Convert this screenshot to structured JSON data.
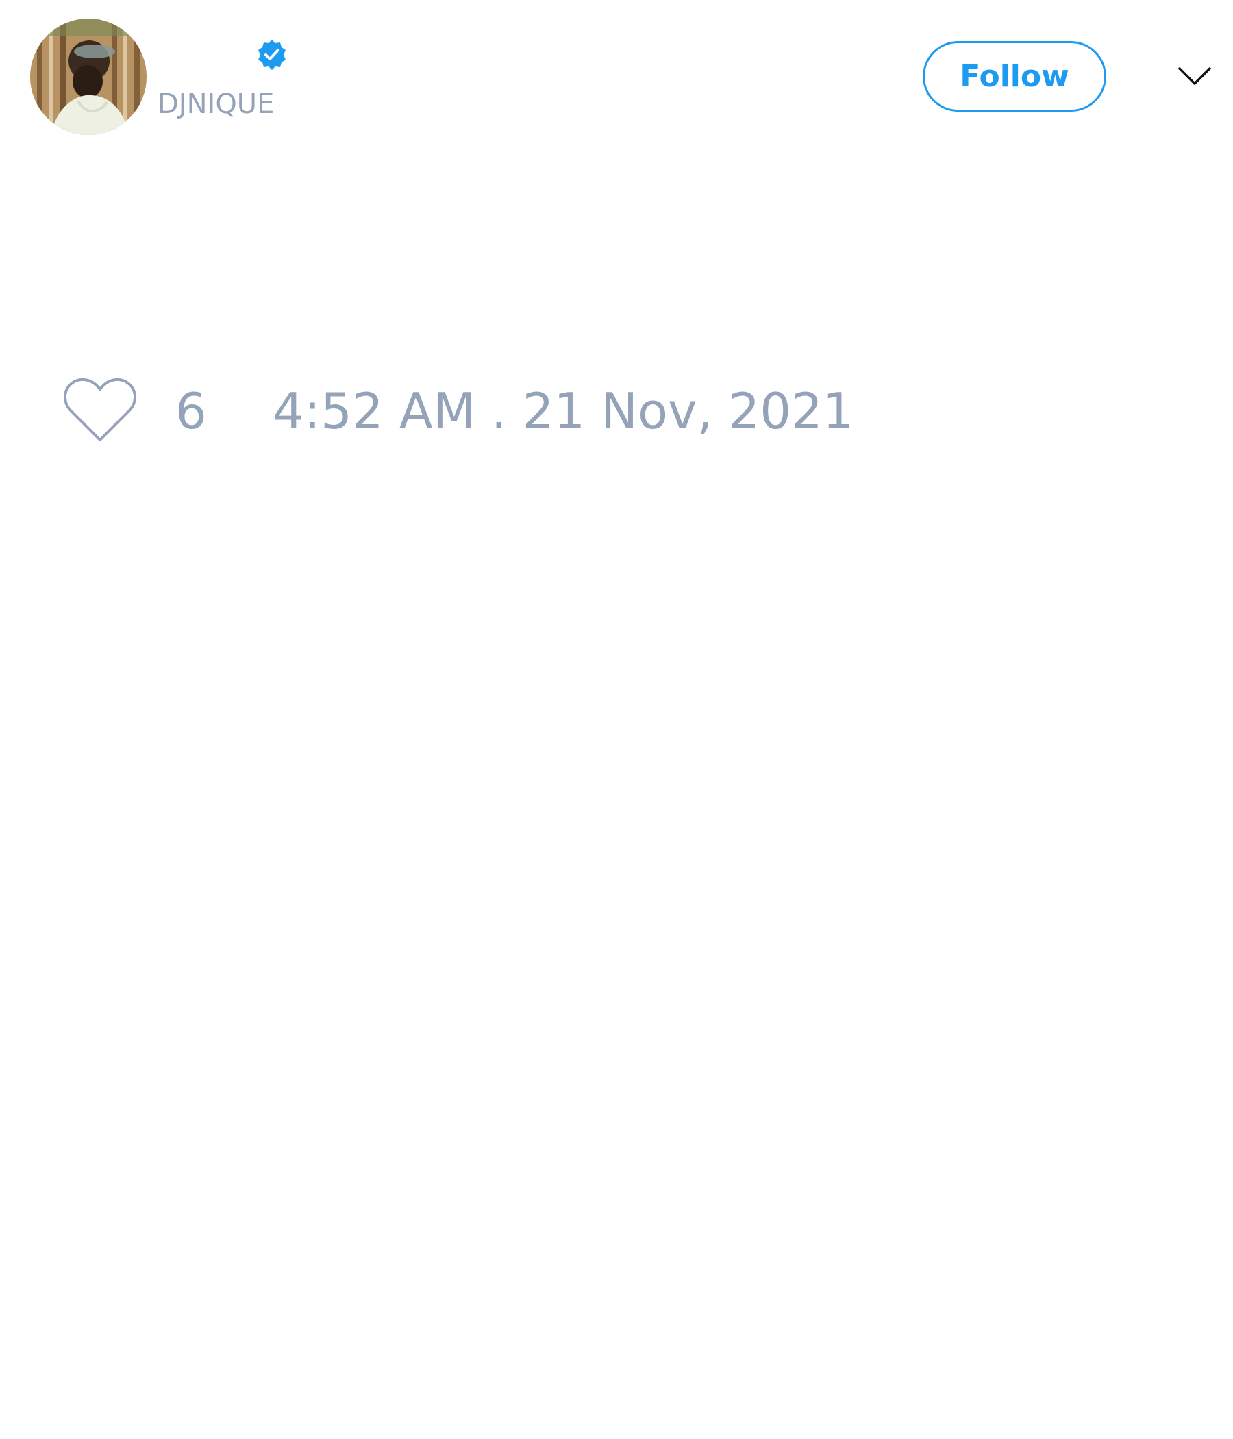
{
  "tweet": {
    "author": {
      "handle": "DJNIQUE",
      "verified": true,
      "avatar_icon": "profile-photo"
    },
    "follow_button_label": "Follow",
    "menu_icon": "chevron-down-icon",
    "like_icon": "heart-outline-icon",
    "likes": "6",
    "timestamp": "4:52 AM . 21 Nov, 2021"
  },
  "colors": {
    "accent": "#1d9bf0",
    "muted_text": "#94a3b8",
    "background": "#ffffff"
  }
}
